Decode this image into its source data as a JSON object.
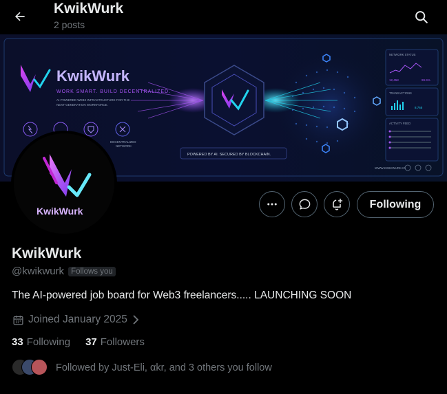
{
  "header": {
    "title": "KwikWurk",
    "post_count": "2 posts"
  },
  "banner": {
    "brand": "KwikWurk",
    "tagline": "WORK SMART. BUILD DECENTRALIZED.",
    "description_line1": "AI-POWERED WEB3 INFRASTRUCTURE FOR THE",
    "description_line2": "NEXT-GENERATION WORKFORCE.",
    "feature_label": "DECENTRALIZED",
    "feature_label2": "NETWORK",
    "powered_by": "POWERED BY AI. SECURED BY BLOCKCHAIN.",
    "network_status": "NETWORK STATUS",
    "transactions": "TRANSACTIONS",
    "activity_feed": "ACTIVITY FEED",
    "website": "WWW.KWIKWURK.IO",
    "stat1": "12,458",
    "stat2": "99.9%",
    "stat3": "8,765"
  },
  "avatar": {
    "brand": "KwikWurk"
  },
  "actions": {
    "following_label": "Following"
  },
  "profile": {
    "name": "KwikWurk",
    "handle": "@kwikwurk",
    "follows_you": "Follows you",
    "bio": "The AI-powered job board for Web3 freelancers..... LAUNCHING SOON",
    "joined": "Joined January 2025",
    "following_count": "33",
    "following_label": "Following",
    "followers_count": "37",
    "followers_label": "Followers",
    "followed_by": "Followed by Just-Eli, αkr, and 3 others you follow"
  },
  "colors": {
    "background": "#000000",
    "text_primary": "#e7e9ea",
    "text_secondary": "#71767b",
    "border": "#536471",
    "brand_purple": "#a855f7",
    "brand_cyan": "#22d3ee"
  }
}
